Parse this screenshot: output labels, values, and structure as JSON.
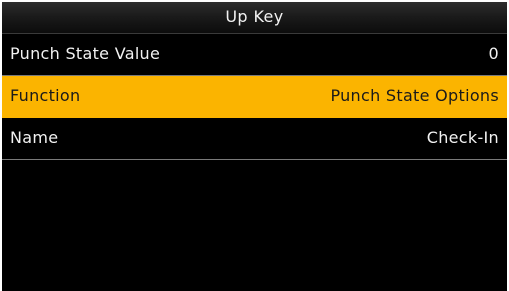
{
  "title_bar": {
    "title": "Up Key"
  },
  "settings": {
    "rows": [
      {
        "label": "Punch State Value",
        "value": "0",
        "selected": false
      },
      {
        "label": "Function",
        "value": "Punch State Options",
        "selected": true
      },
      {
        "label": "Name",
        "value": "Check-In",
        "selected": false
      }
    ]
  },
  "colors": {
    "background": "#000000",
    "highlight": "#fbb400",
    "text": "#f2f2f2",
    "highlight_text": "#1a1a1a",
    "divider": "#7a7a7a"
  }
}
